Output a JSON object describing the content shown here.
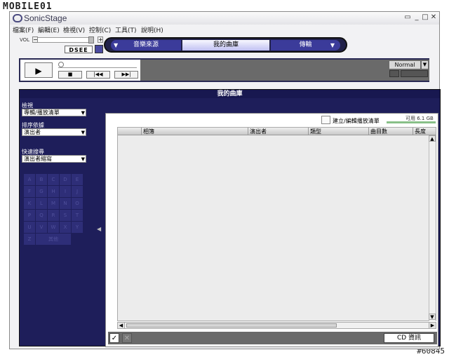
{
  "watermark": {
    "logo": "MOBILE01",
    "post_id": "#60845"
  },
  "window": {
    "title": "SonicStage",
    "controls": {
      "settings": "▭",
      "minimize": "_",
      "maximize": "□",
      "close": "✕"
    }
  },
  "menu": [
    "檔案(F)",
    "編輯(E)",
    "檢視(V)",
    "控制(C)",
    "工具(T)",
    "說明(H)"
  ],
  "volume": {
    "label": "VOL",
    "minus": "−",
    "plus": "+"
  },
  "dsee": {
    "label": "DSEE"
  },
  "nav": {
    "tabs": [
      {
        "label": "音樂來源",
        "active": false
      },
      {
        "label": "我的曲庫",
        "active": true
      },
      {
        "label": "傳輸",
        "active": false
      }
    ],
    "arrow": "▼"
  },
  "player": {
    "play": "▶",
    "stop": "■",
    "prev": "|◀◀",
    "next": "▶▶|",
    "mode": "Normal",
    "mode_arrow": "▼"
  },
  "library": {
    "title": "我的曲庫",
    "view_label": "檢視",
    "view_value": "專輯/播放清單",
    "sort_label": "排序依據",
    "sort_value": "演出者",
    "quick_label": "快速搜尋",
    "quick_value": "演出者縮寫",
    "letters": [
      "A",
      "B",
      "C",
      "D",
      "E",
      "F",
      "G",
      "H",
      "I",
      "J",
      "K",
      "L",
      "M",
      "N",
      "O",
      "P",
      "Q",
      "R",
      "S",
      "T",
      "U",
      "V",
      "W",
      "X",
      "Y",
      "Z",
      "其他"
    ],
    "collapse_arrow": "◀"
  },
  "content": {
    "playlist_label": "建立/編輯播放清單",
    "capacity": "可用 6.1 GB",
    "columns": [
      "相簿",
      "演出者",
      "類型",
      "曲目數",
      "長度"
    ],
    "scroll": {
      "up": "▲",
      "down": "▼",
      "left": "◀",
      "right": "▶"
    },
    "check_icon": "✓",
    "x_icon": "✕",
    "cd_info": "CD 資訊"
  }
}
